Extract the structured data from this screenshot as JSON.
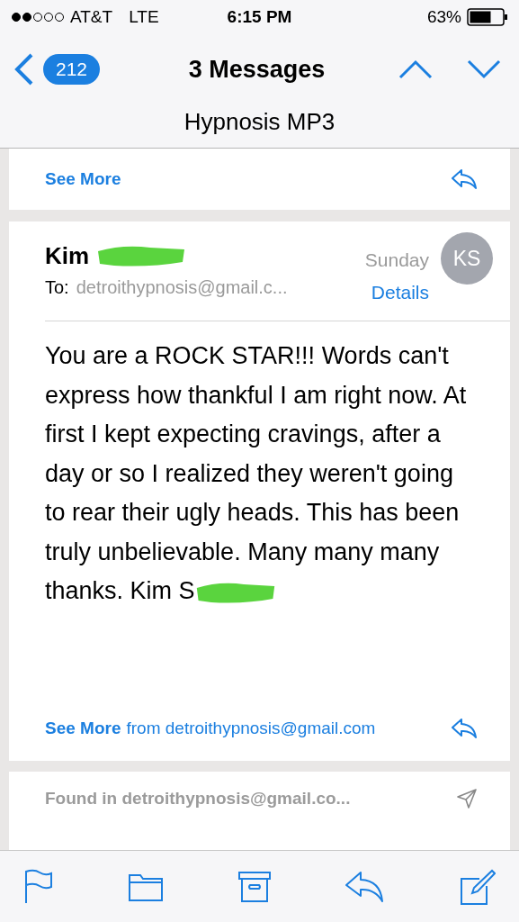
{
  "status_bar": {
    "carrier": "AT&T",
    "network": "LTE",
    "time": "6:15 PM",
    "battery": "63%"
  },
  "nav": {
    "back_count": "212",
    "title": "3 Messages",
    "subject": "Hypnosis MP3"
  },
  "messages": [
    {
      "kind": "collapsed",
      "link": "See More"
    },
    {
      "kind": "full",
      "sender": "Kim",
      "date": "Sunday",
      "to_label": "To:",
      "to": "detroithypnosis@gmail.c...",
      "details": "Details",
      "initials": "KS",
      "body": "You are a ROCK STAR!!! Words can't express how thankful I am right now.  At first I  kept expecting cravings, after a day or so I realized they weren't going to rear their ugly heads. This has been truly unbelievable.  Many many many thanks.  Kim S",
      "see_more": "See More",
      "see_more_from": "from detroithypnosis@gmail.com"
    },
    {
      "kind": "found",
      "text": "Found in detroithypnosis@gmail.co..."
    }
  ]
}
